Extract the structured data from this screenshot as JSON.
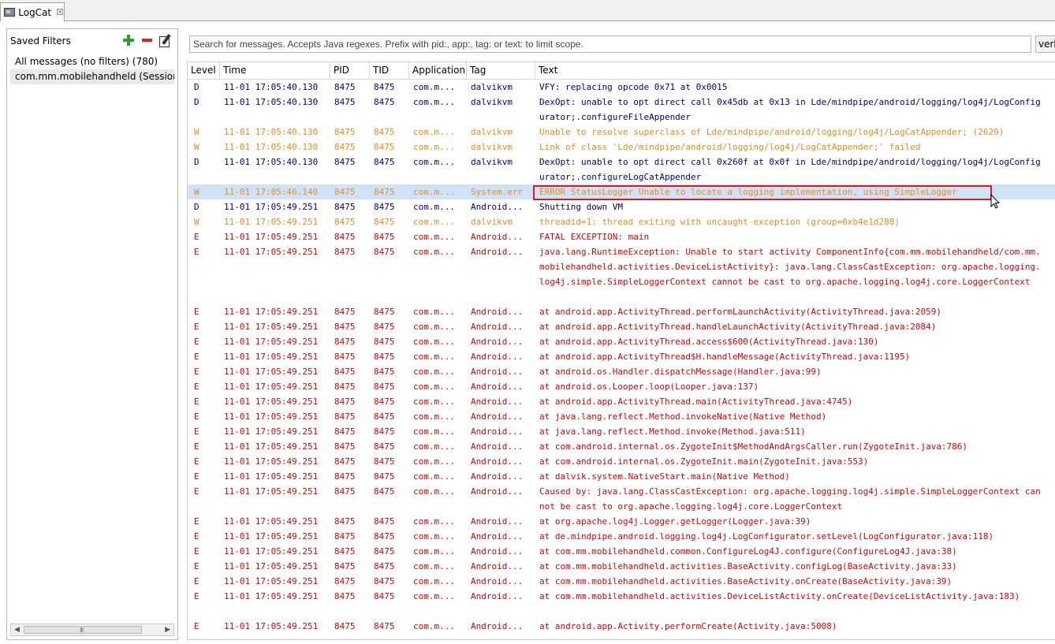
{
  "tab": {
    "title": "LogCat",
    "close": "☒"
  },
  "left_panel": {
    "title": "Saved Filters",
    "filters": [
      "All messages (no filters) (780)",
      "com.mm.mobilehandheld (Session Filter)"
    ],
    "scroll_grip": "III"
  },
  "search": {
    "placeholder": "Search for messages. Accepts Java regexes. Prefix with pid:, app:, tag: or text: to limit scope."
  },
  "level_select": {
    "value": "verbose"
  },
  "columns": [
    "Level",
    "Time",
    "PID",
    "TID",
    "Application",
    "Tag",
    "Text"
  ],
  "colors": {
    "debug": "#00007f",
    "warn": "#f08a14",
    "error": "#e00000",
    "selection": "#cfe3f8",
    "highlight_box": "#e01818"
  },
  "rows": [
    {
      "level": "D",
      "time": "11-01 17:05:40.130",
      "pid": "8475",
      "tid": "8475",
      "app": "com.m...",
      "tag": "dalvikvm",
      "text": "VFY: replacing opcode 0x71 at 0x0015",
      "lines": 1
    },
    {
      "level": "D",
      "time": "11-01 17:05:40.130",
      "pid": "8475",
      "tid": "8475",
      "app": "com.m...",
      "tag": "dalvikvm",
      "text": "DexOpt: unable to opt direct call 0x45db at 0x13 in Lde/mindpipe/android/logging/log4j/LogConfigurator;.configureFileAppender",
      "lines": 2
    },
    {
      "level": "W",
      "time": "11-01 17:05:40.130",
      "pid": "8475",
      "tid": "8475",
      "app": "com.m...",
      "tag": "dalvikvm",
      "text": "Unable to resolve superclass of Lde/mindpipe/android/logging/log4j/LogCatAppender; (2629)",
      "lines": 1
    },
    {
      "level": "W",
      "time": "11-01 17:05:40.130",
      "pid": "8475",
      "tid": "8475",
      "app": "com.m...",
      "tag": "dalvikvm",
      "text": "Link of class 'Lde/mindpipe/android/logging/log4j/LogCatAppender;' failed",
      "lines": 1
    },
    {
      "level": "D",
      "time": "11-01 17:05:40.130",
      "pid": "8475",
      "tid": "8475",
      "app": "com.m...",
      "tag": "dalvikvm",
      "text": "DexOpt: unable to opt direct call 0x260f at 0x0f in Lde/mindpipe/android/logging/log4j/LogConfigurator;.configureLogCatAppender",
      "lines": 2
    },
    {
      "level": "W",
      "time": "11-01 17:05:46.140",
      "pid": "8475",
      "tid": "8475",
      "app": "com.m...",
      "tag": "System.err",
      "text": "ERROR StatusLogger Unable to locate a logging implementation, using SimpleLogger",
      "lines": 1,
      "selected": true
    },
    {
      "level": "D",
      "time": "11-01 17:05:49.251",
      "pid": "8475",
      "tid": "8475",
      "app": "com.m...",
      "tag": "Android...",
      "text": "Shutting down VM",
      "lines": 1
    },
    {
      "level": "W",
      "time": "11-01 17:05:49.251",
      "pid": "8475",
      "tid": "8475",
      "app": "com.m...",
      "tag": "dalvikvm",
      "text": "threadid=1: thread exiting with uncaught exception (group=0xb4e1d288)",
      "lines": 1
    },
    {
      "level": "E",
      "time": "11-01 17:05:49.251",
      "pid": "8475",
      "tid": "8475",
      "app": "com.m...",
      "tag": "Android...",
      "text": "FATAL EXCEPTION: main",
      "lines": 1
    },
    {
      "level": "E",
      "time": "11-01 17:05:49.251",
      "pid": "8475",
      "tid": "8475",
      "app": "com.m...",
      "tag": "Android...",
      "text": "java.lang.RuntimeException: Unable to start activity ComponentInfo{com.mm.mobilehandheld/com.mm.mobilehandheld.activities.DeviceListActivity}: java.lang.ClassCastException: org.apache.logging.log4j.simple.SimpleLoggerContext cannot be cast to org.apache.logging.log4j.core.LoggerContext",
      "lines": 4
    },
    {
      "level": "E",
      "time": "11-01 17:05:49.251",
      "pid": "8475",
      "tid": "8475",
      "app": "com.m...",
      "tag": "Android...",
      "text": "at android.app.ActivityThread.performLaunchActivity(ActivityThread.java:2059)",
      "lines": 1
    },
    {
      "level": "E",
      "time": "11-01 17:05:49.251",
      "pid": "8475",
      "tid": "8475",
      "app": "com.m...",
      "tag": "Android...",
      "text": "at android.app.ActivityThread.handleLaunchActivity(ActivityThread.java:2084)",
      "lines": 1
    },
    {
      "level": "E",
      "time": "11-01 17:05:49.251",
      "pid": "8475",
      "tid": "8475",
      "app": "com.m...",
      "tag": "Android...",
      "text": "at android.app.ActivityThread.access$600(ActivityThread.java:130)",
      "lines": 1
    },
    {
      "level": "E",
      "time": "11-01 17:05:49.251",
      "pid": "8475",
      "tid": "8475",
      "app": "com.m...",
      "tag": "Android...",
      "text": "at android.app.ActivityThread$H.handleMessage(ActivityThread.java:1195)",
      "lines": 1
    },
    {
      "level": "E",
      "time": "11-01 17:05:49.251",
      "pid": "8475",
      "tid": "8475",
      "app": "com.m...",
      "tag": "Android...",
      "text": "at android.os.Handler.dispatchMessage(Handler.java:99)",
      "lines": 1
    },
    {
      "level": "E",
      "time": "11-01 17:05:49.251",
      "pid": "8475",
      "tid": "8475",
      "app": "com.m...",
      "tag": "Android...",
      "text": "at android.os.Looper.loop(Looper.java:137)",
      "lines": 1
    },
    {
      "level": "E",
      "time": "11-01 17:05:49.251",
      "pid": "8475",
      "tid": "8475",
      "app": "com.m...",
      "tag": "Android...",
      "text": "at android.app.ActivityThread.main(ActivityThread.java:4745)",
      "lines": 1
    },
    {
      "level": "E",
      "time": "11-01 17:05:49.251",
      "pid": "8475",
      "tid": "8475",
      "app": "com.m...",
      "tag": "Android...",
      "text": "at java.lang.reflect.Method.invokeNative(Native Method)",
      "lines": 1
    },
    {
      "level": "E",
      "time": "11-01 17:05:49.251",
      "pid": "8475",
      "tid": "8475",
      "app": "com.m...",
      "tag": "Android...",
      "text": "at java.lang.reflect.Method.invoke(Method.java:511)",
      "lines": 1
    },
    {
      "level": "E",
      "time": "11-01 17:05:49.251",
      "pid": "8475",
      "tid": "8475",
      "app": "com.m...",
      "tag": "Android...",
      "text": "at com.android.internal.os.ZygoteInit$MethodAndArgsCaller.run(ZygoteInit.java:786)",
      "lines": 1
    },
    {
      "level": "E",
      "time": "11-01 17:05:49.251",
      "pid": "8475",
      "tid": "8475",
      "app": "com.m...",
      "tag": "Android...",
      "text": "at com.android.internal.os.ZygoteInit.main(ZygoteInit.java:553)",
      "lines": 1
    },
    {
      "level": "E",
      "time": "11-01 17:05:49.251",
      "pid": "8475",
      "tid": "8475",
      "app": "com.m...",
      "tag": "Android...",
      "text": "at dalvik.system.NativeStart.main(Native Method)",
      "lines": 1
    },
    {
      "level": "E",
      "time": "11-01 17:05:49.251",
      "pid": "8475",
      "tid": "8475",
      "app": "com.m...",
      "tag": "Android...",
      "text": "Caused by: java.lang.ClassCastException: org.apache.logging.log4j.simple.SimpleLoggerContext cannot be cast to org.apache.logging.log4j.core.LoggerContext",
      "lines": 2
    },
    {
      "level": "E",
      "time": "11-01 17:05:49.251",
      "pid": "8475",
      "tid": "8475",
      "app": "com.m...",
      "tag": "Android...",
      "text": "at org.apache.log4j.Logger.getLogger(Logger.java:39)",
      "lines": 1
    },
    {
      "level": "E",
      "time": "11-01 17:05:49.251",
      "pid": "8475",
      "tid": "8475",
      "app": "com.m...",
      "tag": "Android...",
      "text": "at de.mindpipe.android.logging.log4j.LogConfigurator.setLevel(LogConfigurator.java:118)",
      "lines": 1
    },
    {
      "level": "E",
      "time": "11-01 17:05:49.251",
      "pid": "8475",
      "tid": "8475",
      "app": "com.m...",
      "tag": "Android...",
      "text": "at com.mm.mobilehandheld.common.ConfigureLog4J.configure(ConfigureLog4J.java:38)",
      "lines": 1
    },
    {
      "level": "E",
      "time": "11-01 17:05:49.251",
      "pid": "8475",
      "tid": "8475",
      "app": "com.m...",
      "tag": "Android...",
      "text": "at com.mm.mobilehandheld.activities.BaseActivity.configLog(BaseActivity.java:33)",
      "lines": 1
    },
    {
      "level": "E",
      "time": "11-01 17:05:49.251",
      "pid": "8475",
      "tid": "8475",
      "app": "com.m...",
      "tag": "Android...",
      "text": "at com.mm.mobilehandheld.activities.BaseActivity.onCreate(BaseActivity.java:39)",
      "lines": 1
    },
    {
      "level": "E",
      "time": "11-01 17:05:49.251",
      "pid": "8475",
      "tid": "8475",
      "app": "com.m...",
      "tag": "Android...",
      "text": "at com.mm.mobilehandheld.activities.DeviceListActivity.onCreate(DeviceListActivity.java:183)",
      "lines": 2
    },
    {
      "level": "E",
      "time": "11-01 17:05:49.251",
      "pid": "8475",
      "tid": "8475",
      "app": "com.m...",
      "tag": "Android...",
      "text": "at android.app.Activity.performCreate(Activity.java:5008)",
      "lines": 1
    }
  ]
}
